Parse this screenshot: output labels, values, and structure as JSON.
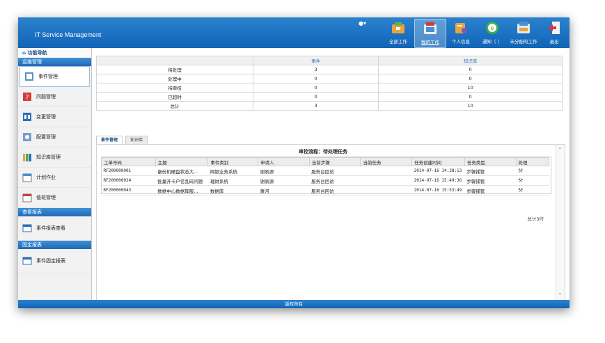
{
  "app": {
    "title": "IT Service Management"
  },
  "header": {
    "nav": [
      {
        "label": "全部工作",
        "icon": "folder-briefcase-icon"
      },
      {
        "label": "我的工作",
        "icon": "my-work-icon"
      },
      {
        "label": "个人信息",
        "icon": "person-card-icon"
      },
      {
        "label": "通知（ ）",
        "icon": "bell-icon"
      },
      {
        "label": "未分配的工作",
        "icon": "inbox-icon"
      },
      {
        "label": "退出",
        "icon": "exit-door-icon"
      }
    ]
  },
  "sidebar": {
    "title": "功能导航",
    "sections": [
      {
        "label": "运维管理",
        "items": [
          "事件管理",
          "问题管理",
          "变更管理",
          "配置管理",
          "知识库管理",
          "计划作业",
          "值班管理"
        ]
      },
      {
        "label": "查看报表",
        "items": [
          "事件报表查看"
        ]
      },
      {
        "label": "固定报表",
        "items": [
          "事件固定报表"
        ]
      }
    ]
  },
  "summary": {
    "headers": [
      "",
      "事件",
      "知识库"
    ],
    "rows": [
      [
        "待处理",
        "3",
        "0"
      ],
      [
        "处理中",
        "0",
        "0"
      ],
      [
        "待审核",
        "0",
        "10"
      ],
      [
        "已超时",
        "0",
        "0"
      ],
      [
        "总计",
        "3",
        "10"
      ]
    ]
  },
  "tabs": [
    "事件管理",
    "知识库"
  ],
  "grid": {
    "title": "审控流程：待处理任务",
    "columns": [
      "工单号码",
      "主题",
      "事件类别",
      "申请人",
      "当前步骤",
      "当前任务",
      "任务创建时间",
      "任务类型",
      "处理"
    ],
    "rows": [
      [
        "RF200000001",
        "备份机硬盘状态大...",
        "网银业务系统",
        "谢表源",
        "服务台回访",
        "",
        "2014-07-16 14:38:13",
        "步骤捕管",
        ""
      ],
      [
        "RF200000024",
        "批量开卡户名乱码问题",
        "理财系统",
        "谢表源",
        "服务台回访",
        "",
        "2014-07-16 15:49:36",
        "步骤捕管",
        ""
      ],
      [
        "RF200000043",
        "数据中心数据库服...",
        "数据库",
        "黄河",
        "服务台回访",
        "",
        "2014-07-16 15:53:49",
        "步骤捕管",
        ""
      ]
    ],
    "total": "总计3行"
  },
  "footer": {
    "text": "版权所有"
  },
  "colors": {
    "header_blue": "#1a6fc2",
    "section_blue": "#2b7ccb"
  }
}
